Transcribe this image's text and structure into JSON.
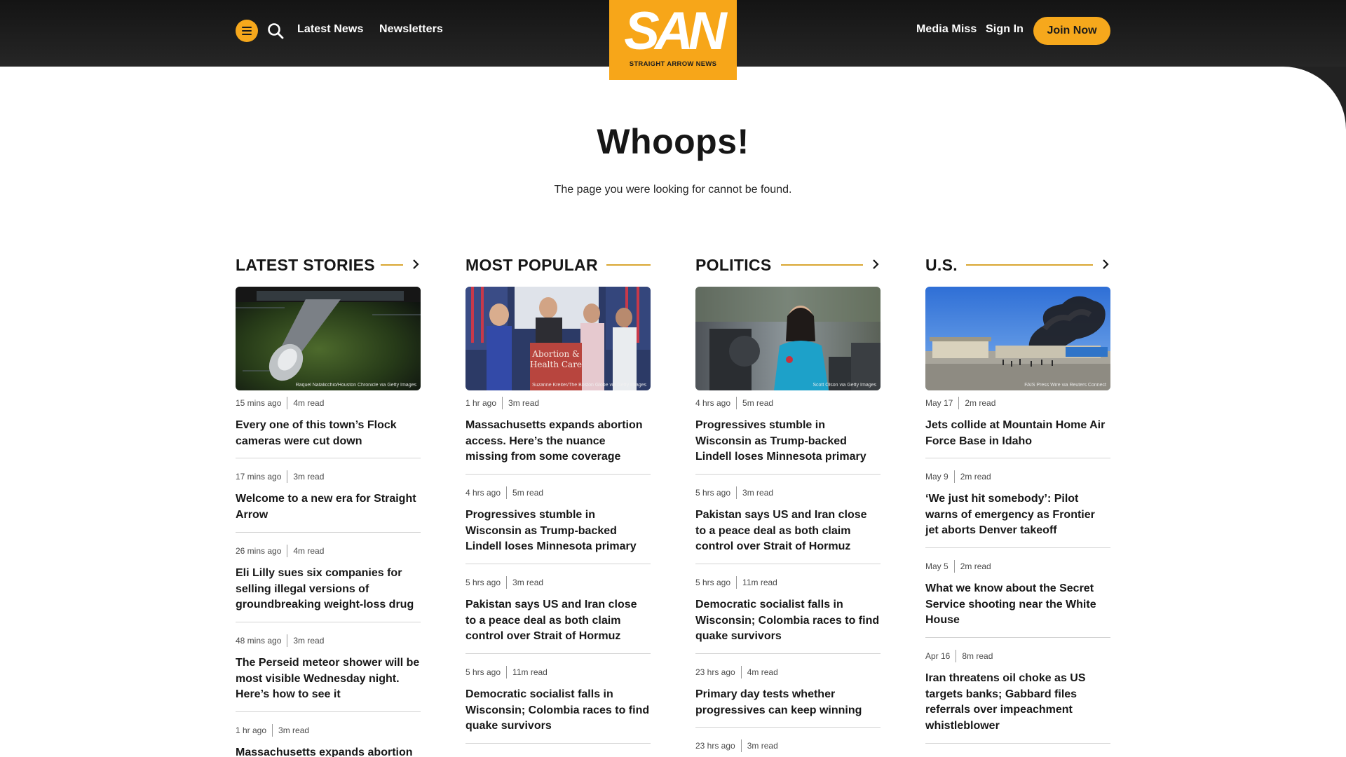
{
  "header": {
    "nav_left": [
      "Latest News",
      "Newsletters"
    ],
    "logo_mark": "SAN",
    "logo_sub": "STRAIGHT ARROW NEWS",
    "nav_right": [
      "Media Miss",
      "Sign In"
    ],
    "join_label": "Join Now",
    "icons": {
      "menu": "hamburger-menu-icon",
      "search": "search-icon"
    },
    "colors": {
      "accent": "#f6a81c",
      "bar": "#1b1b1b"
    }
  },
  "error": {
    "title": "Whoops!",
    "message": "The page you were looking for cannot be found."
  },
  "columns": [
    {
      "title": "LATEST STORIES",
      "has_arrow": true,
      "image_credit": "Raquel Natalicchio/Houston Chronicle via Getty Images",
      "stories": [
        {
          "time": "15 mins ago",
          "read": "4m read",
          "headline": "Every one of this town’s Flock cameras were cut down"
        },
        {
          "time": "17 mins ago",
          "read": "3m read",
          "headline": "Welcome to a new era for Straight Arrow"
        },
        {
          "time": "26 mins ago",
          "read": "4m read",
          "headline": "Eli Lilly sues six companies for selling illegal versions of groundbreaking weight-loss drug"
        },
        {
          "time": "48 mins ago",
          "read": "3m read",
          "headline": "The Perseid meteor shower will be most visible Wednesday night. Here’s how to see it"
        },
        {
          "time": "1 hr ago",
          "read": "3m read",
          "headline": "Massachusetts expands abortion"
        }
      ]
    },
    {
      "title": "MOST POPULAR",
      "has_arrow": false,
      "image_credit": "Suzanne Kreiter/The Boston Globe via Getty Images",
      "image_sign": "Abortion & Health Care",
      "stories": [
        {
          "time": "1 hr ago",
          "read": "3m read",
          "headline": "Massachusetts expands abortion access. Here’s the nuance missing from some coverage"
        },
        {
          "time": "4 hrs ago",
          "read": "5m read",
          "headline": "Progressives stumble in Wisconsin as Trump-backed Lindell loses Minnesota primary"
        },
        {
          "time": "5 hrs ago",
          "read": "3m read",
          "headline": "Pakistan says US and Iran close to a peace deal as both claim control over Strait of Hormuz"
        },
        {
          "time": "5 hrs ago",
          "read": "11m read",
          "headline": "Democratic socialist falls in Wisconsin; Colombia races to find quake survivors"
        }
      ]
    },
    {
      "title": "POLITICS",
      "has_arrow": true,
      "image_credit": "Scott Olson via Getty Images",
      "stories": [
        {
          "time": "4 hrs ago",
          "read": "5m read",
          "headline": "Progressives stumble in Wisconsin as Trump-backed Lindell loses Minnesota primary"
        },
        {
          "time": "5 hrs ago",
          "read": "3m read",
          "headline": "Pakistan says US and Iran close to a peace deal as both claim control over Strait of Hormuz"
        },
        {
          "time": "5 hrs ago",
          "read": "11m read",
          "headline": "Democratic socialist falls in Wisconsin; Colombia races to find quake survivors"
        },
        {
          "time": "23 hrs ago",
          "read": "4m read",
          "headline": "Primary day tests whether progressives can keep winning"
        },
        {
          "time": "23 hrs ago",
          "read": "3m read",
          "headline": ""
        }
      ]
    },
    {
      "title": "U.S.",
      "has_arrow": true,
      "image_credit": "FAIS Press Wire via Reuters Connect",
      "stories": [
        {
          "time": "May 17",
          "read": "2m read",
          "headline": "Jets collide at Mountain Home Air Force Base in Idaho"
        },
        {
          "time": "May 9",
          "read": "2m read",
          "headline": "‘We just hit somebody’: Pilot warns of emergency as Frontier jet aborts Denver takeoff"
        },
        {
          "time": "May 5",
          "read": "2m read",
          "headline": "What we know about the Secret Service shooting near the White House"
        },
        {
          "time": "Apr 16",
          "read": "8m read",
          "headline": "Iran threatens oil choke as US targets banks; Gabbard files referrals over impeachment whistleblower"
        }
      ]
    }
  ]
}
